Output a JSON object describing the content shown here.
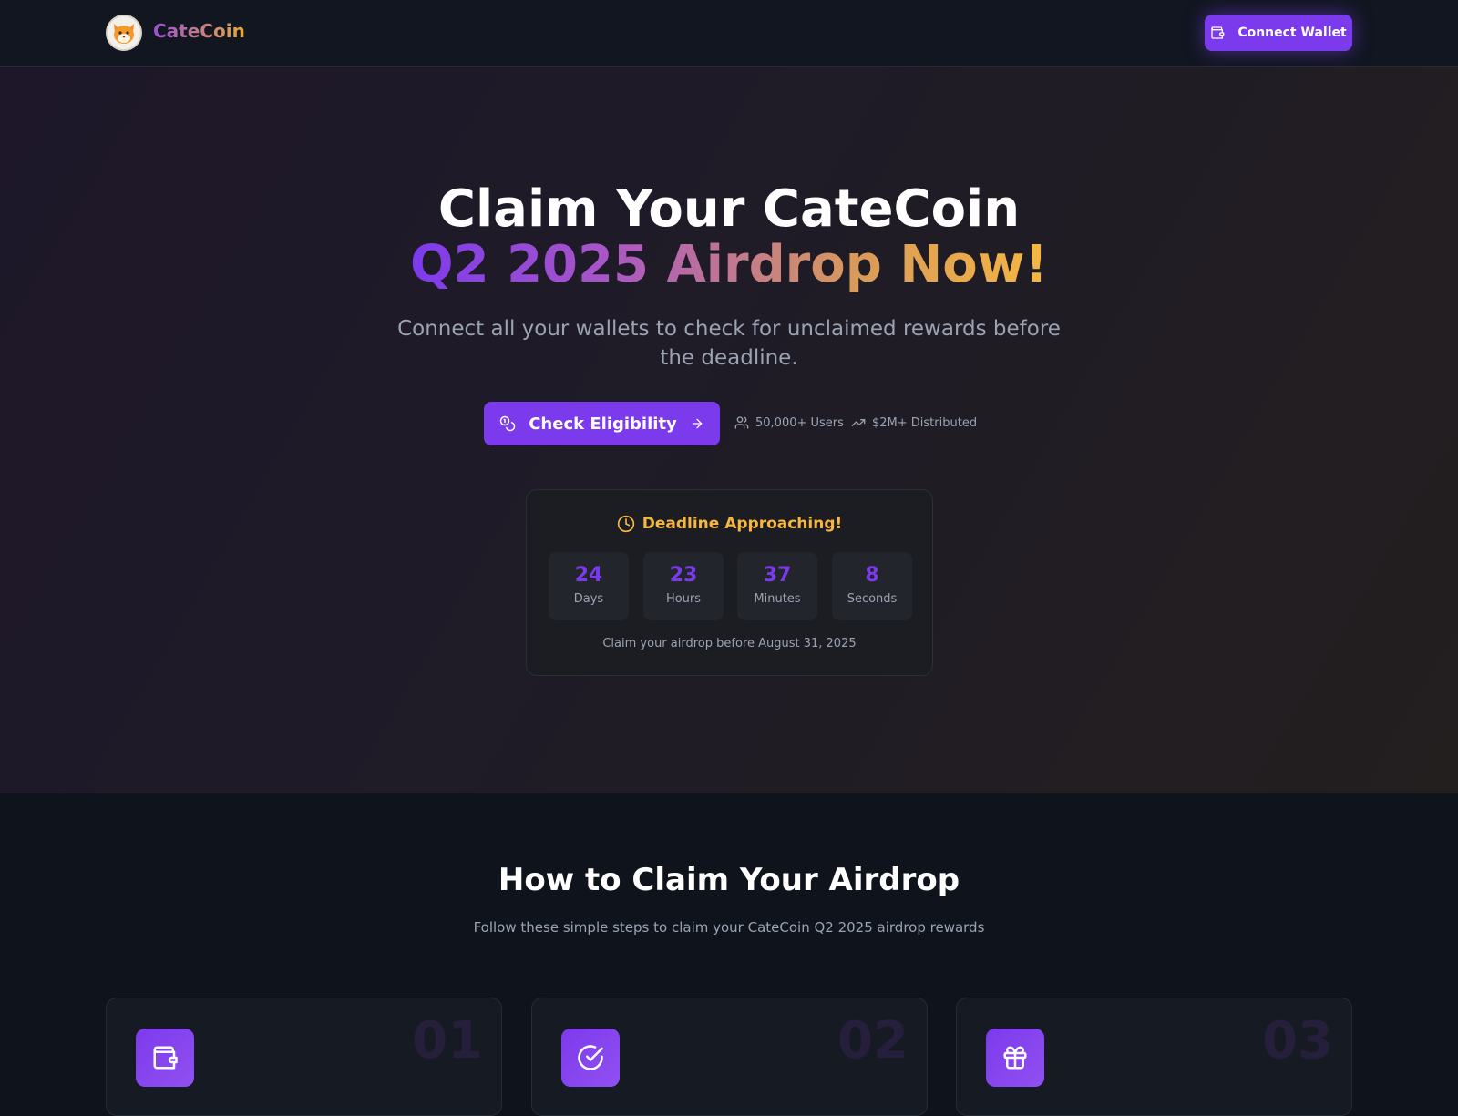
{
  "nav": {
    "logo_icon": "cat-face-icon",
    "brand": "CateCoin",
    "connect_label": "Connect Wallet",
    "connect_icon": "wallet-icon"
  },
  "hero": {
    "title_line1": "Claim Your CateCoin",
    "title_line2": "Q2 2025 Airdrop Now!",
    "subtitle": "Connect all your wallets to check for unclaimed rewards before the deadline.",
    "cta_label": "Check Eligibility",
    "cta_icon": "coins-icon",
    "cta_arrow_icon": "arrow-right-icon",
    "stats": [
      {
        "icon": "users-icon",
        "text": "50,000+ Users"
      },
      {
        "icon": "trending-up-icon",
        "text": "$2M+ Distributed"
      }
    ]
  },
  "deadline": {
    "icon": "clock-icon",
    "title": "Deadline Approaching!",
    "countdown": [
      {
        "value": "24",
        "unit": "Days"
      },
      {
        "value": "23",
        "unit": "Hours"
      },
      {
        "value": "37",
        "unit": "Minutes"
      },
      {
        "value": "8",
        "unit": "Seconds"
      }
    ],
    "note": "Claim your airdrop before August 31, 2025"
  },
  "how": {
    "title": "How to Claim Your Airdrop",
    "subtitle": "Follow these simple steps to claim your CateCoin Q2 2025 airdrop rewards",
    "steps": [
      {
        "number": "01",
        "icon": "wallet-icon"
      },
      {
        "number": "02",
        "icon": "check-circle-icon"
      },
      {
        "number": "03",
        "icon": "gift-icon"
      }
    ]
  },
  "colors": {
    "accent": "#7c3aed",
    "gold": "#f5b742",
    "background": "#0f141c",
    "muted_text": "#9aa3b2"
  }
}
